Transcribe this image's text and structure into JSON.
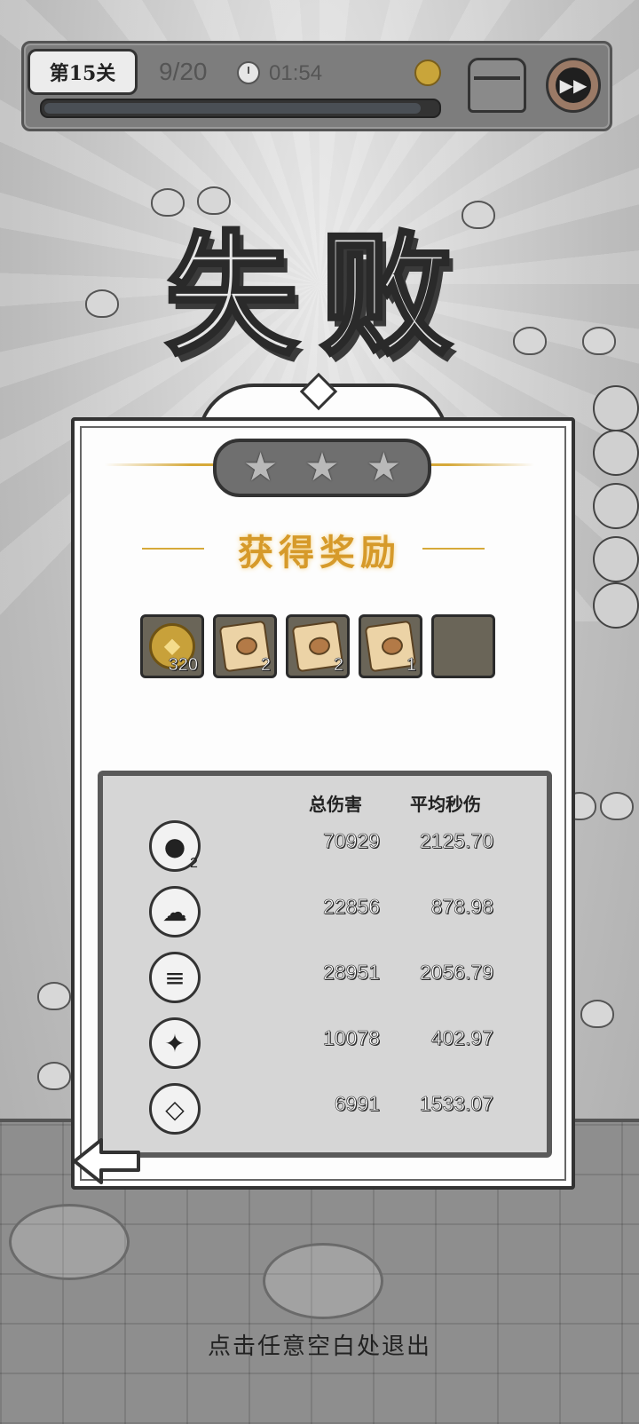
{
  "hud": {
    "level": "第15关",
    "wave": "9/20",
    "timer": "01:54",
    "progress": 0.96
  },
  "result": {
    "title": "失败",
    "stars_earned": 0,
    "stars_total": 3
  },
  "rewards": {
    "title": "获得奖励",
    "items": [
      {
        "icon": "gold-coin-icon",
        "count": "320"
      },
      {
        "icon": "fish-scroll-icon",
        "count": "2"
      },
      {
        "icon": "boot-scroll-icon",
        "count": "2"
      },
      {
        "icon": "hat-scroll-icon",
        "count": "1"
      },
      {
        "icon": "empty-slot",
        "count": ""
      }
    ]
  },
  "stats": {
    "header_total": "总伤害",
    "header_dps": "平均秒伤",
    "rows": [
      {
        "icon": "ink-splash-skill-icon",
        "level": "2",
        "total": "70929",
        "dps": "2125.70"
      },
      {
        "icon": "ghost-skill-icon",
        "level": "",
        "total": "22856",
        "dps": "878.98"
      },
      {
        "icon": "icicle-skill-icon",
        "level": "",
        "total": "28951",
        "dps": "2056.79"
      },
      {
        "icon": "crystal-skill-icon",
        "level": "",
        "total": "10078",
        "dps": "402.97"
      },
      {
        "icon": "paper-plane-skill-icon",
        "level": "",
        "total": "6991",
        "dps": "1533.07"
      }
    ]
  },
  "exit_hint": "点击任意空白处退出"
}
